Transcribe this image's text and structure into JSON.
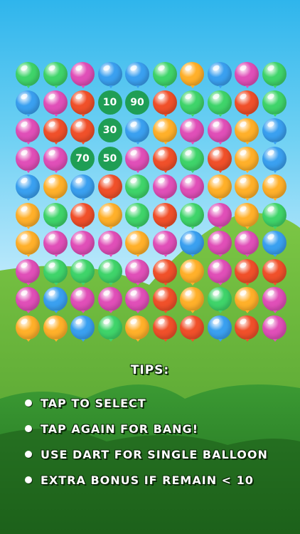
{
  "board": {
    "rows": [
      [
        "green",
        "green",
        "magenta",
        "blue",
        "blue",
        "green",
        "orange",
        "blue",
        "magenta",
        "green"
      ],
      [
        "blue",
        "magenta",
        "red",
        "score:10",
        "score:90",
        "red",
        "green",
        "green",
        "red",
        "green"
      ],
      [
        "magenta",
        "red",
        "red",
        "score:30",
        "blue",
        "orange",
        "magenta",
        "magenta",
        "orange",
        "blue"
      ],
      [
        "magenta",
        "magenta",
        "score:70",
        "score:50",
        "magenta",
        "red",
        "green",
        "red",
        "orange",
        "blue"
      ],
      [
        "blue",
        "orange",
        "blue",
        "red",
        "green",
        "magenta",
        "magenta",
        "orange",
        "orange",
        "orange"
      ],
      [
        "orange",
        "green",
        "red",
        "orange",
        "green",
        "red",
        "green",
        "magenta",
        "orange",
        "green"
      ],
      [
        "orange",
        "magenta",
        "magenta",
        "magenta",
        "orange",
        "magenta",
        "blue",
        "magenta",
        "magenta",
        "blue"
      ],
      [
        "magenta",
        "green",
        "green",
        "green",
        "magenta",
        "red",
        "orange",
        "magenta",
        "red",
        "red"
      ],
      [
        "magenta",
        "blue",
        "magenta",
        "magenta",
        "magenta",
        "red",
        "orange",
        "green",
        "orange",
        "magenta"
      ],
      [
        "orange",
        "orange",
        "blue",
        "green",
        "orange",
        "red",
        "red",
        "blue",
        "red",
        "magenta"
      ]
    ]
  },
  "colors": {
    "green": "#3fd46a",
    "blue": "#3aa0f0",
    "magenta": "#e04fb8",
    "red": "#f0502a",
    "orange": "#ffb02a",
    "score_bubble": "#1f9e55",
    "hill_back": "#6eb83f",
    "hill_front": "#2f8a2a"
  },
  "tips": {
    "title": "TIPS:",
    "items": [
      "TAP TO SELECT",
      "TAP AGAIN FOR BANG!",
      "USE DART FOR SINGLE BALLOON",
      "EXTRA BONUS IF REMAIN < 10"
    ]
  }
}
